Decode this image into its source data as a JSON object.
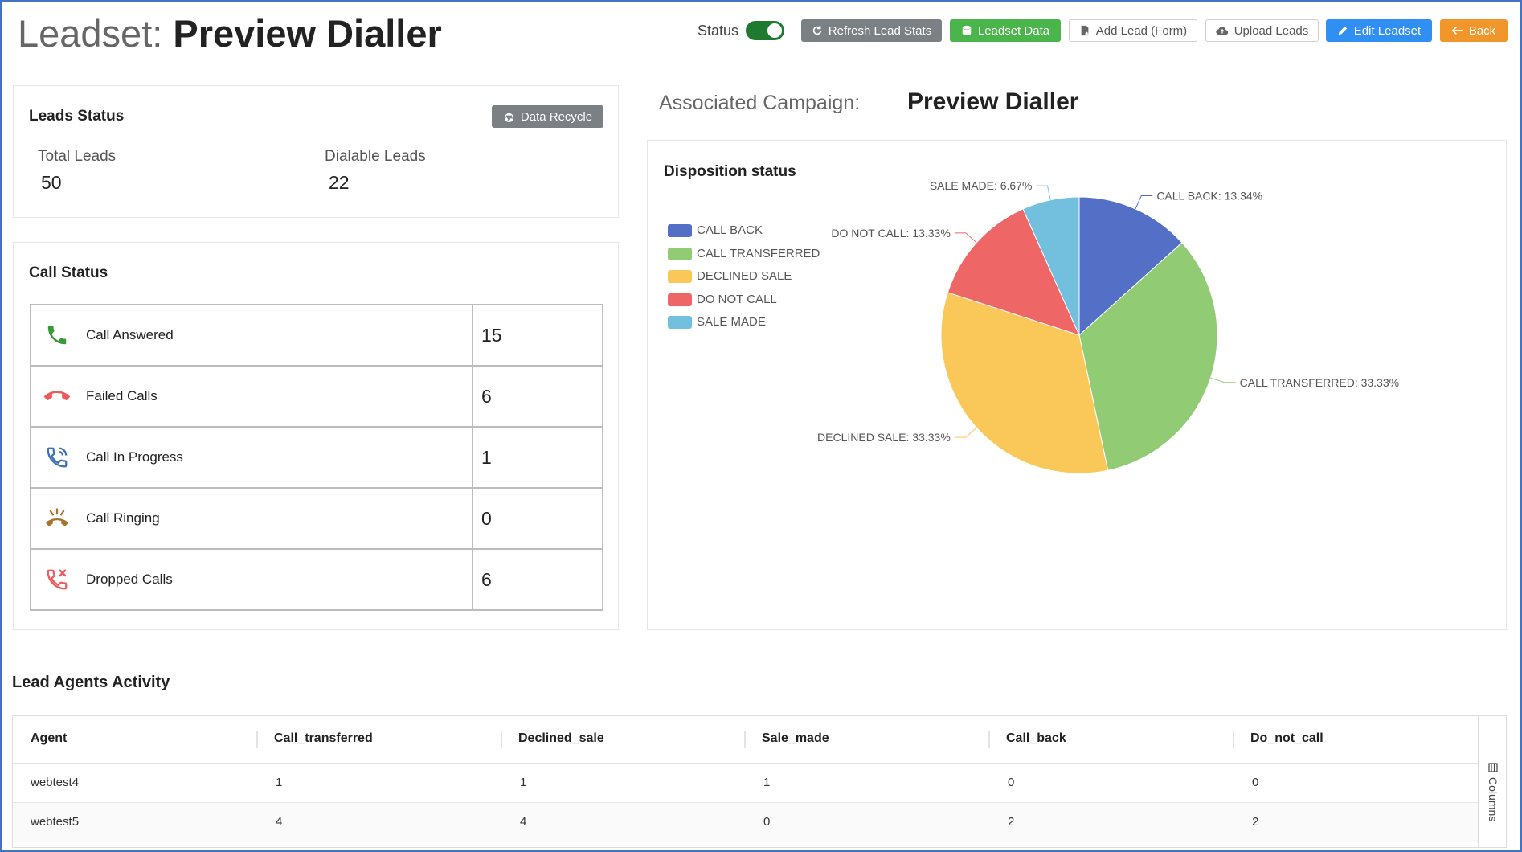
{
  "header": {
    "title_prefix": "Leadset:",
    "title_name": "Preview Dialler",
    "status_label": "Status",
    "status_on": true,
    "buttons": {
      "refresh": "Refresh Lead Stats",
      "leadset_data": "Leadset Data",
      "add_lead": "Add Lead (Form)",
      "upload": "Upload Leads",
      "edit": "Edit Leadset",
      "back": "Back"
    }
  },
  "leads_status": {
    "title": "Leads Status",
    "recycle_label": "Data Recycle",
    "total_label": "Total Leads",
    "total_value": "50",
    "dialable_label": "Dialable Leads",
    "dialable_value": "22"
  },
  "call_status": {
    "title": "Call Status",
    "rows": [
      {
        "label": "Call Answered",
        "value": "15",
        "icon": "phone-answered-icon",
        "color": "#3a9a3a"
      },
      {
        "label": "Failed Calls",
        "value": "6",
        "icon": "phone-hangup-icon",
        "color": "#ef5b5b"
      },
      {
        "label": "Call In Progress",
        "value": "1",
        "icon": "phone-in-progress-icon",
        "color": "#3f6fb5"
      },
      {
        "label": "Call Ringing",
        "value": "0",
        "icon": "phone-ringing-icon",
        "color": "#a8742a"
      },
      {
        "label": "Dropped Calls",
        "value": "6",
        "icon": "phone-dropped-icon",
        "color": "#ef5b5b"
      }
    ]
  },
  "campaign": {
    "label": "Associated Campaign:",
    "name": "Preview Dialler"
  },
  "disposition": {
    "title": "Disposition status"
  },
  "chart_data": {
    "type": "pie",
    "categories": [
      "CALL BACK",
      "CALL TRANSFERRED",
      "DECLINED SALE",
      "DO NOT CALL",
      "SALE MADE"
    ],
    "values": [
      13.34,
      33.33,
      33.33,
      13.33,
      6.67
    ],
    "labels": [
      "CALL BACK: 13.34%",
      "CALL TRANSFERRED: 33.33%",
      "DECLINED SALE: 33.33%",
      "DO NOT CALL: 13.33%",
      "SALE MADE: 6.67%"
    ],
    "colors": [
      "#5470c6",
      "#91cc75",
      "#fac858",
      "#ee6666",
      "#73c0de"
    ],
    "legend": "left"
  },
  "agents": {
    "title": "Lead Agents Activity",
    "columns": [
      "Agent",
      "Call_transferred",
      "Declined_sale",
      "Sale_made",
      "Call_back",
      "Do_not_call"
    ],
    "rows": [
      [
        "webtest4",
        "1",
        "1",
        "1",
        "0",
        "0"
      ],
      [
        "webtest5",
        "4",
        "4",
        "0",
        "2",
        "2"
      ]
    ],
    "columns_tab": "Columns"
  }
}
